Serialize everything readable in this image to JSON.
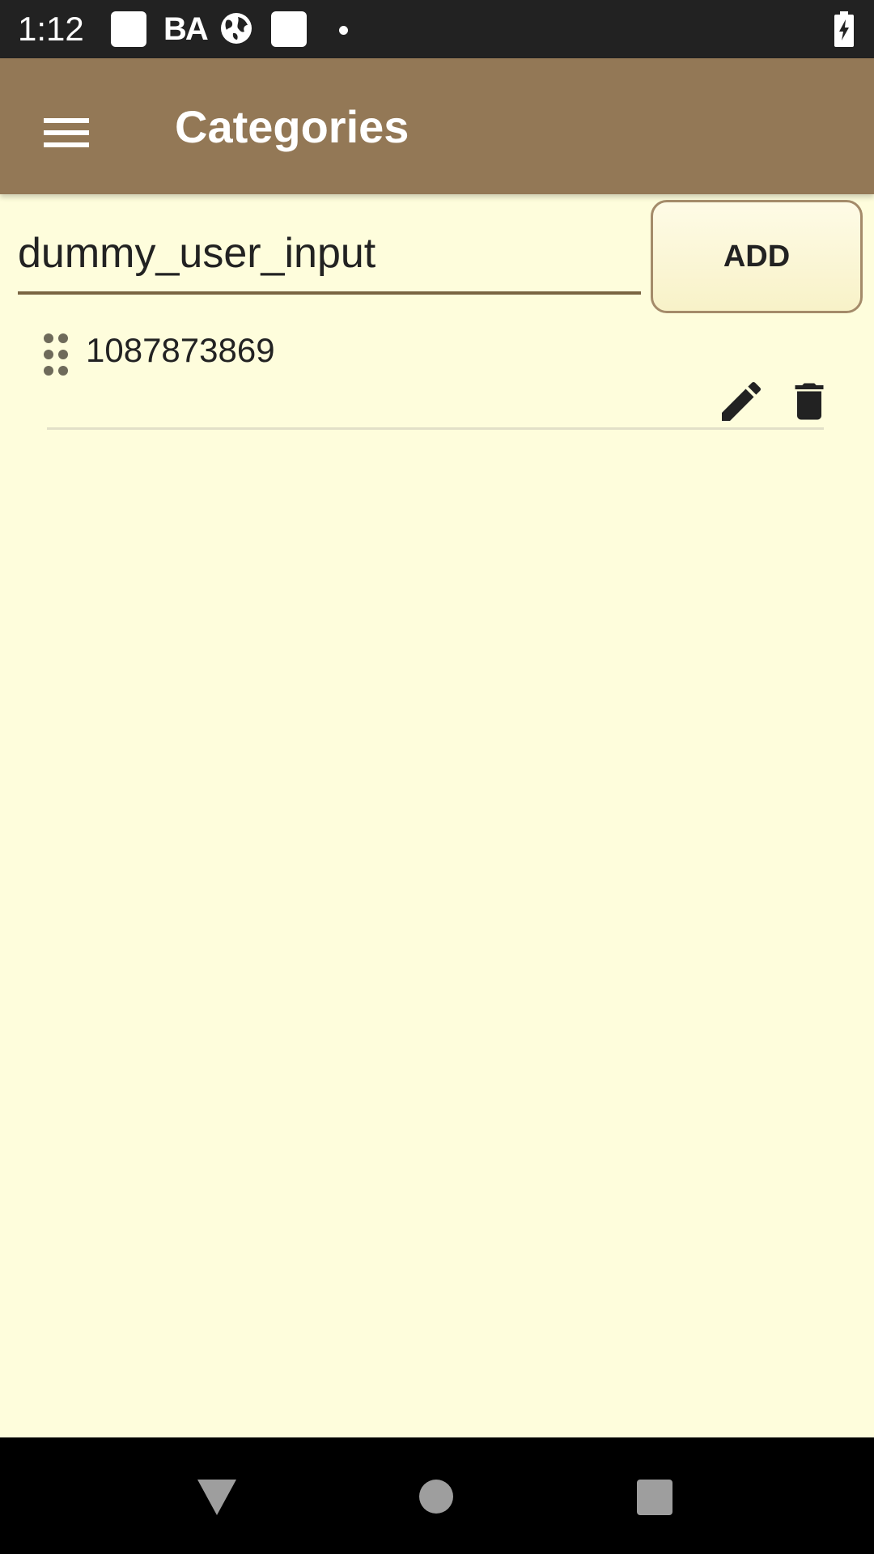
{
  "status_bar": {
    "time": "1:12",
    "ba_label": "BA",
    "icons": [
      "white-square-icon",
      "ba-icon",
      "globe-icon",
      "white-square-icon",
      "dot-icon",
      "battery-charging-icon"
    ]
  },
  "app_bar": {
    "title": "Categories",
    "menu_icon": "hamburger-menu-icon",
    "color": "#937856"
  },
  "input": {
    "value": "dummy_user_input",
    "placeholder": ""
  },
  "add_button": {
    "label": "ADD"
  },
  "categories": [
    {
      "label": "1087873869",
      "icons": [
        "drag-handle-icon",
        "edit-icon",
        "delete-icon"
      ]
    }
  ],
  "colors": {
    "background": "#fefddc",
    "accent": "#937856",
    "status_bar": "#222222",
    "nav_bar": "#000000"
  },
  "nav_bar": {
    "icons": [
      "back-icon",
      "home-icon",
      "recents-icon"
    ]
  }
}
